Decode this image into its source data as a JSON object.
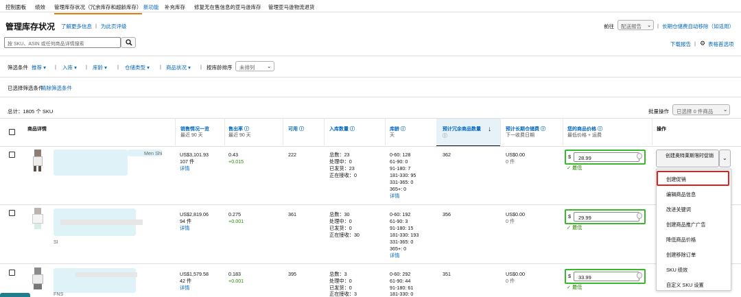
{
  "topnav": [
    "控制面板",
    "绩效",
    "管理库存状况（冗余库存和超龄库存）",
    "新功能",
    "补充库存",
    "修复无在售信息的亚马逊库存",
    "管理亚马逊物流退货"
  ],
  "title": "管理库存状况",
  "links": {
    "learn_more": "了解更多信息",
    "rate": "为此页评级",
    "goto": "前往",
    "goto_select": "配送报告",
    "auto_remove": "长期仓储费自动移除（如适用）",
    "download": "下载报告",
    "table_pref": "表格首选项"
  },
  "search": {
    "placeholder": "按 SKU、ASIN 或任何商品详情搜索"
  },
  "filters": {
    "label": "筛选条件",
    "items": [
      "推荐",
      "入库",
      "库龄",
      "仓储类型",
      "商品状况"
    ],
    "sort_label": "按库龄排序",
    "sort_value": "未排列",
    "applied": "已选择筛选条件",
    "clear": "清除筛选条件"
  },
  "total": "总计：1805 个 SKU",
  "bulk": {
    "label": "批量操作",
    "value": "已选择 0 件商品"
  },
  "headers": {
    "details": "商品详情",
    "sales": "销售情况一览",
    "sales_sub": "最近 90 天",
    "sellthru": "售出率 ⓘ",
    "sellthru_sub": "最近 90 天",
    "available": "可用 ⓘ",
    "inbound": "入库数量 ⓘ",
    "age": "库龄 ⓘ",
    "age_sub": "天",
    "excess": "预计冗余商品数量",
    "excess_sub": "ⓘ",
    "ltsf": "预计长期仓储费 ⓘ",
    "ltsf_sub": "下一收费日期",
    "price": "您的商品价格 ⓘ",
    "price_sub": "最低价格 + 运费",
    "action": "操作"
  },
  "rows": [
    {
      "title": "Men Shi",
      "sales": "US$3,101.93",
      "units": "107 件",
      "detail": "详情",
      "sell": "0.43",
      "sell_d": "+0.015",
      "avail": "222",
      "in_total": "总数：23",
      "in_proc": "处理中：0",
      "in_ship": "已发货：23",
      "in_recv": "正在接收：0",
      "age": [
        "0-60: 128",
        "61-90: 0",
        "91-180: 7",
        "181-330: 95",
        "331-365: 0",
        "365+: 0"
      ],
      "age_detail": "详情",
      "excess": "362",
      "ltsf": "US$0.00",
      "ltsf_u": "0 件",
      "price": "28.99",
      "lowest": "最低"
    },
    {
      "title": "SI",
      "sales": "US$2,819.06",
      "units": "94 件",
      "detail": "详情",
      "sell": "0.275",
      "sell_d": "+0.001",
      "avail": "361",
      "in_total": "总数：30",
      "in_proc": "处理中：0",
      "in_ship": "已发货：0",
      "in_recv": "正在接收：30",
      "age": [
        "0-60: 192",
        "61-90: 3",
        "91-180: 15",
        "181-330: 193",
        "331-365: 0",
        "365+: 0"
      ],
      "age_detail": "详情",
      "excess": "356",
      "ltsf": "US$0.00",
      "ltsf_u": "0 件",
      "price": "29.99",
      "lowest": "最低"
    },
    {
      "title": "FNS",
      "sales": "US$1,579.58",
      "units": "42 件",
      "detail": "详情",
      "sell": "0.183",
      "sell_d": "+0.001",
      "avail": "395",
      "in_total": "总数：3",
      "in_proc": "处理中：0",
      "in_ship": "已发货：0",
      "in_recv": "正在接收：3",
      "age": [
        "0-60: 292",
        "61-90: 44",
        "91-180: 61",
        "181-330: 0"
      ],
      "age_detail": "",
      "excess": "351",
      "ltsf": "US$0.00",
      "ltsf_u": "0 件",
      "price": "33.99",
      "lowest": "最低"
    }
  ],
  "action_button": "创建奥特莱斯限时促销",
  "menu": [
    "创建促销",
    "编辑商品信息",
    "改进关键词",
    "创建商品推广广告",
    "降低商品价格",
    "创建移除订单",
    "SKU 绩效",
    "自定义 SKU 设置"
  ],
  "colors": {
    "accent": "#e47911",
    "link": "#0066c0",
    "green": "#2b8a00",
    "highlight_green": "#3ab72d",
    "highlight_red": "#e02020"
  }
}
